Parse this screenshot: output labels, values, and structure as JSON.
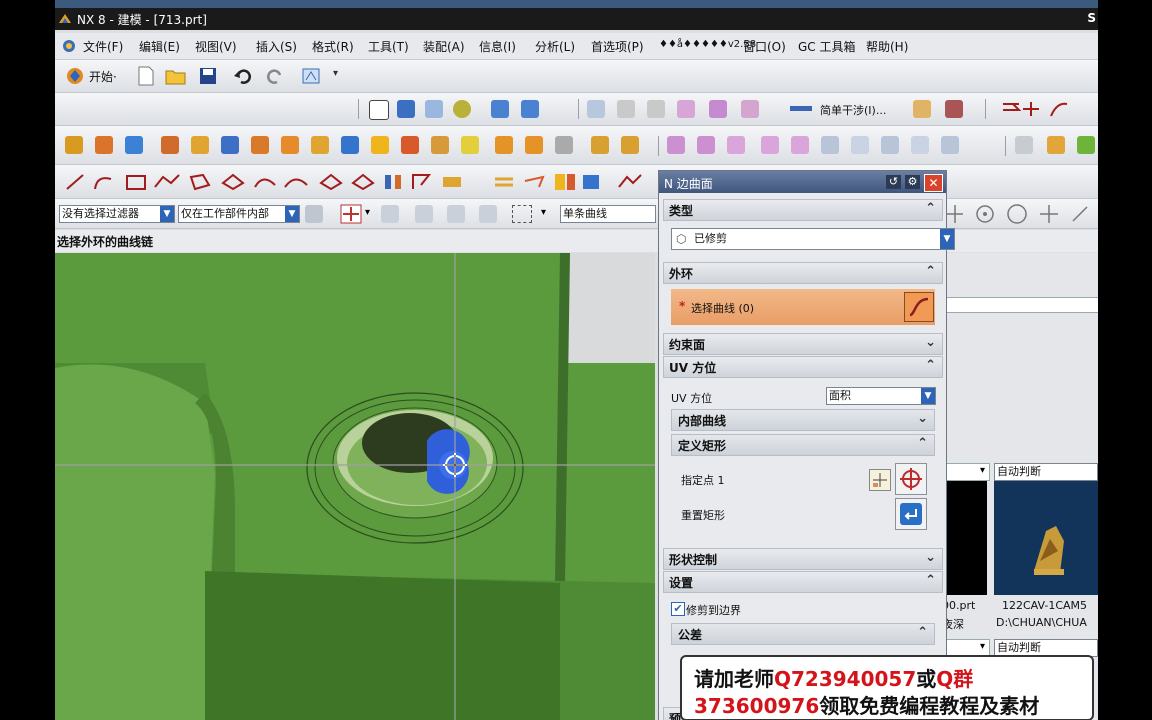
{
  "window": {
    "title": "NX 8 - 建模 - [713.prt]",
    "corner_text": "S"
  },
  "menu": [
    "文件(F)",
    "编辑(E)",
    "视图(V)",
    "插入(S)",
    "格式(R)",
    "工具(T)",
    "装配(A)",
    "信息(I)",
    "分析(L)",
    "首选项(P)",
    "♦♦å♦♦♦♦♦v2.58",
    "窗口(O)",
    "GC 工具箱",
    "帮助(H)"
  ],
  "standard_toolbar": {
    "start_label": "开始·"
  },
  "toolbar_row3": {
    "dropdown_label": "简单干涉(I)..."
  },
  "selection_bar": {
    "filter": "没有选择过滤器",
    "scope": "仅在工作部件内部",
    "curve_rule": "单条曲线"
  },
  "status_hint": "选择外环的曲线链",
  "dialog": {
    "title": "N 边曲面",
    "type_section": "类型",
    "type_value": "已修剪",
    "outer_loop_section": "外环",
    "select_curve": "选择曲线 (0)",
    "constraint_section": "约束面",
    "uv_section": "UV 方位",
    "uv_label": "UV 方位",
    "uv_value": "面积",
    "inner_curves_section": "内部曲线",
    "define_rect_section": "定义矩形",
    "specify_point": "指定点 1",
    "reset_rect": "重置矩形",
    "shape_control_section": "形状控制",
    "settings_section": "设置",
    "trim_to_boundary": "修剪到边界",
    "tolerance_section": "公差",
    "preview_section": "预"
  },
  "right_panel": {
    "dropdown1": "自动判断",
    "dropdown2": "自动判断",
    "file1_name": "00.prt",
    "file1_sub": "夜深",
    "file2_name": "122CAV-1CAM5",
    "file2_path": "D:\\CHUAN\\CHUA"
  },
  "watermark": {
    "line1_a": "请加老师",
    "line1_b": "Q723940057",
    "line1_c": "或",
    "line1_d": "Q群",
    "line2_a": "373600976",
    "line2_b": "领取免费编程教程及素材"
  }
}
